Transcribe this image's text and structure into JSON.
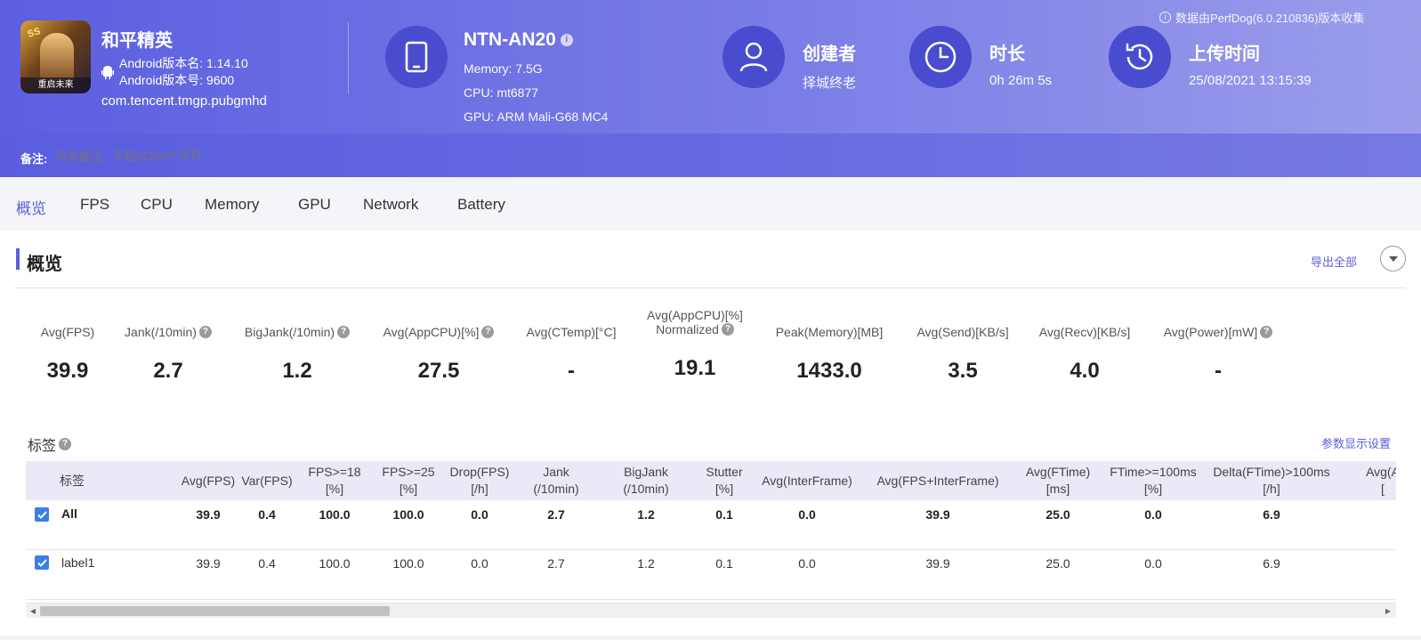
{
  "app": {
    "name": "和平精英",
    "version_name": "Android版本名: 1.14.10",
    "version_code": "Android版本号: 9600",
    "package": "com.tencent.tmgp.pubgmhd",
    "icon_badge": "SS",
    "icon_strip": "重启未来"
  },
  "device": {
    "name": "NTN-AN20",
    "info_glyph": "i",
    "memory": "Memory: 7.5G",
    "cpu": "CPU: mt6877",
    "gpu": "GPU: ARM Mali-G68 MC4"
  },
  "creator": {
    "title": "创建者",
    "value": "择城终老"
  },
  "duration": {
    "title": "时长",
    "value": "0h 26m 5s"
  },
  "upload": {
    "title": "上传时间",
    "value": "25/08/2021 13:15:39"
  },
  "source_note": "数据由PerfDog(6.0.210836)版本收集",
  "note": {
    "label": "备注:",
    "placeholder": "添加备注，不超过200个字符"
  },
  "tabs": [
    "概览",
    "FPS",
    "CPU",
    "Memory",
    "GPU",
    "Network",
    "Battery"
  ],
  "overview": {
    "title": "概览",
    "export_label": "导出全部",
    "metrics": [
      {
        "label": "Avg(FPS)",
        "value": "39.9"
      },
      {
        "label": "Jank(/10min)",
        "value": "2.7"
      },
      {
        "label": "BigJank(/10min)",
        "value": "1.2"
      },
      {
        "label": "Avg(AppCPU)[%]",
        "value": "27.5"
      },
      {
        "label": "Avg(CTemp)[°C]",
        "value": "-"
      },
      {
        "label": "Avg(AppCPU)[%]",
        "label2": "Normalized",
        "value": "19.1"
      },
      {
        "label": "Peak(Memory)[MB]",
        "value": "1433.0"
      },
      {
        "label": "Avg(Send)[KB/s]",
        "value": "3.5"
      },
      {
        "label": "Avg(Recv)[KB/s]",
        "value": "4.0"
      },
      {
        "label": "Avg(Power)[mW]",
        "value": "-"
      }
    ]
  },
  "tags": {
    "title": "标签",
    "param_link": "参数显示设置",
    "headers": [
      "标签",
      "Avg(FPS)",
      "Var(FPS)",
      "FPS>=18|[%]",
      "FPS>=25|[%]",
      "Drop(FPS)|[/h]",
      "Jank|(/10min)",
      "BigJank|(/10min)",
      "Stutter|[%]",
      "Avg(InterFrame)",
      "Avg(FPS+InterFrame)",
      "Avg(FTime)|[ms]",
      "FTime>=100ms|[%]",
      "Delta(FTime)>100ms|[/h]",
      "Avg(A|["
    ],
    "rows": [
      {
        "name": "All",
        "values": [
          "39.9",
          "0.4",
          "100.0",
          "100.0",
          "0.0",
          "2.7",
          "1.2",
          "0.1",
          "0.0",
          "39.9",
          "25.0",
          "0.0",
          "6.9"
        ]
      },
      {
        "name": "label1",
        "values": [
          "39.9",
          "0.4",
          "100.0",
          "100.0",
          "0.0",
          "2.7",
          "1.2",
          "0.1",
          "0.0",
          "39.9",
          "25.0",
          "0.0",
          "6.9"
        ]
      }
    ]
  },
  "scroll": {
    "left_arrow": "◀",
    "right_arrow": "▶"
  },
  "colors": {
    "accent": "#5b5fd9",
    "header_start": "#5c5fe0",
    "header_end": "#9b9deb",
    "checkbox": "#3f7de8"
  }
}
